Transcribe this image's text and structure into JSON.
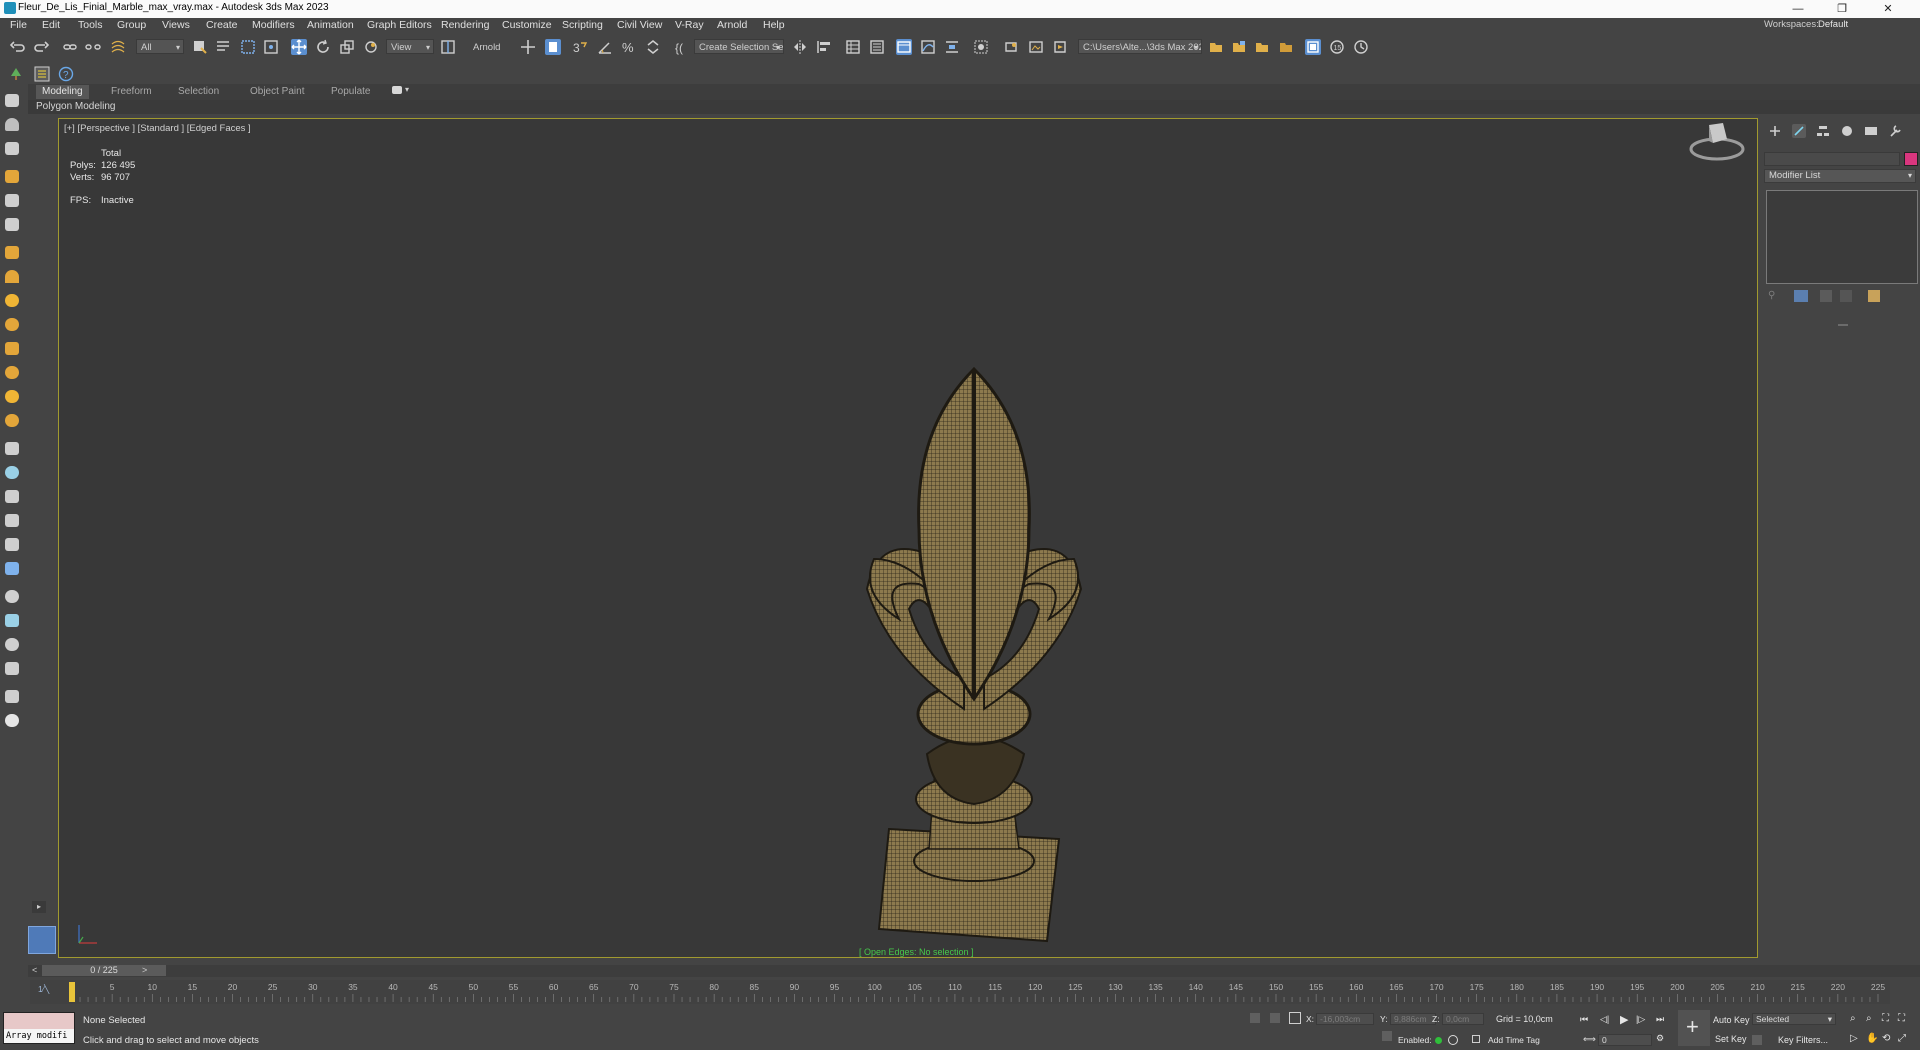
{
  "window": {
    "title": "Fleur_De_Lis_Finial_Marble_max_vray.max - Autodesk 3ds Max 2023",
    "controls": [
      "—",
      "❐",
      "✕"
    ]
  },
  "menu": [
    "File",
    "Edit",
    "Tools",
    "Group",
    "Views",
    "Create",
    "Modifiers",
    "Animation",
    "Graph Editors",
    "Rendering",
    "Customize",
    "Scripting",
    "Civil View",
    "V-Ray",
    "Arnold",
    "Help"
  ],
  "workspace": {
    "label": "Workspaces:",
    "value": "Default"
  },
  "toolbar": {
    "selection_filter": "All",
    "ref_coord": "View",
    "renderer_label": "Arnold",
    "named_selection": "Create Selection Se",
    "project_path": "C:\\Users\\Alte...\\3ds Max 2023"
  },
  "ribbon": {
    "tabs": [
      "Modeling",
      "Freeform",
      "Selection",
      "Object Paint",
      "Populate"
    ],
    "active_tab": "Modeling",
    "panel_label": "Polygon Modeling"
  },
  "viewport": {
    "label": "[+] [Perspective ] [Standard ] [Edged Faces ]",
    "stats": {
      "total_label": "Total",
      "polys_label": "Polys:",
      "polys_value": "126 495",
      "verts_label": "Verts:",
      "verts_value": "96 707",
      "fps_label": "FPS:",
      "fps_value": "Inactive"
    },
    "open_edges": "[ Open Edges: No selection ]"
  },
  "command_panel": {
    "modifier_list": "Modifier List",
    "object_color": "#d9367e"
  },
  "timeline": {
    "position": "0 / 225",
    "prev": "<",
    "next": ">",
    "ticks": [
      "0",
      "5",
      "10",
      "15",
      "20",
      "25",
      "30",
      "35",
      "40",
      "45",
      "50",
      "55",
      "60",
      "65",
      "70",
      "75",
      "80",
      "85",
      "90",
      "95",
      "100",
      "105",
      "110",
      "115",
      "120",
      "125",
      "130",
      "135",
      "140",
      "145",
      "150",
      "155",
      "160",
      "165",
      "170",
      "175",
      "180",
      "185",
      "190",
      "195",
      "200",
      "205",
      "210",
      "215",
      "220",
      "225"
    ]
  },
  "status": {
    "maxscript": "Array modifi",
    "selection": "None Selected",
    "prompt": "Click and drag to select and move objects",
    "x_label": "X:",
    "x_value": "-16,003cm",
    "y_label": "Y:",
    "y_value": "9,886cm",
    "z_label": "Z:",
    "z_value": "0,0cm",
    "grid": "Grid = 10,0cm",
    "enabled_label": "Enabled:",
    "add_time_tag": "Add Time Tag",
    "auto_key": "Auto Key",
    "selected_dd": "Selected",
    "set_key": "Set Key",
    "key_filters": "Key Filters...",
    "frame_value": "0"
  },
  "colors": {
    "ui_bg": "#444444",
    "viewport_bg": "#383838",
    "viewport_border": "#a19a2f",
    "accent_blue": "#5b8fd0",
    "open_edges_green": "#46c94b"
  }
}
